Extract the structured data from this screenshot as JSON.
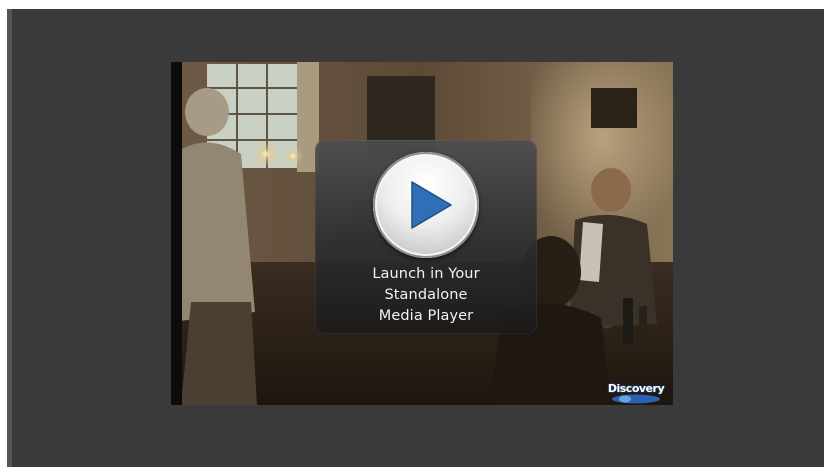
{
  "player": {
    "launch_lines": [
      "Launch in Your",
      "Standalone",
      "Media Player"
    ],
    "logo_text": "Discovery",
    "icons": {
      "play": "play-triangle-icon",
      "logo": "discovery-logo"
    },
    "colors": {
      "frame_background": "#3a3a3a",
      "overlay_card": "#3c3c3c",
      "play_triangle": "#2f6fb8",
      "text": "#f2f2f2"
    }
  }
}
